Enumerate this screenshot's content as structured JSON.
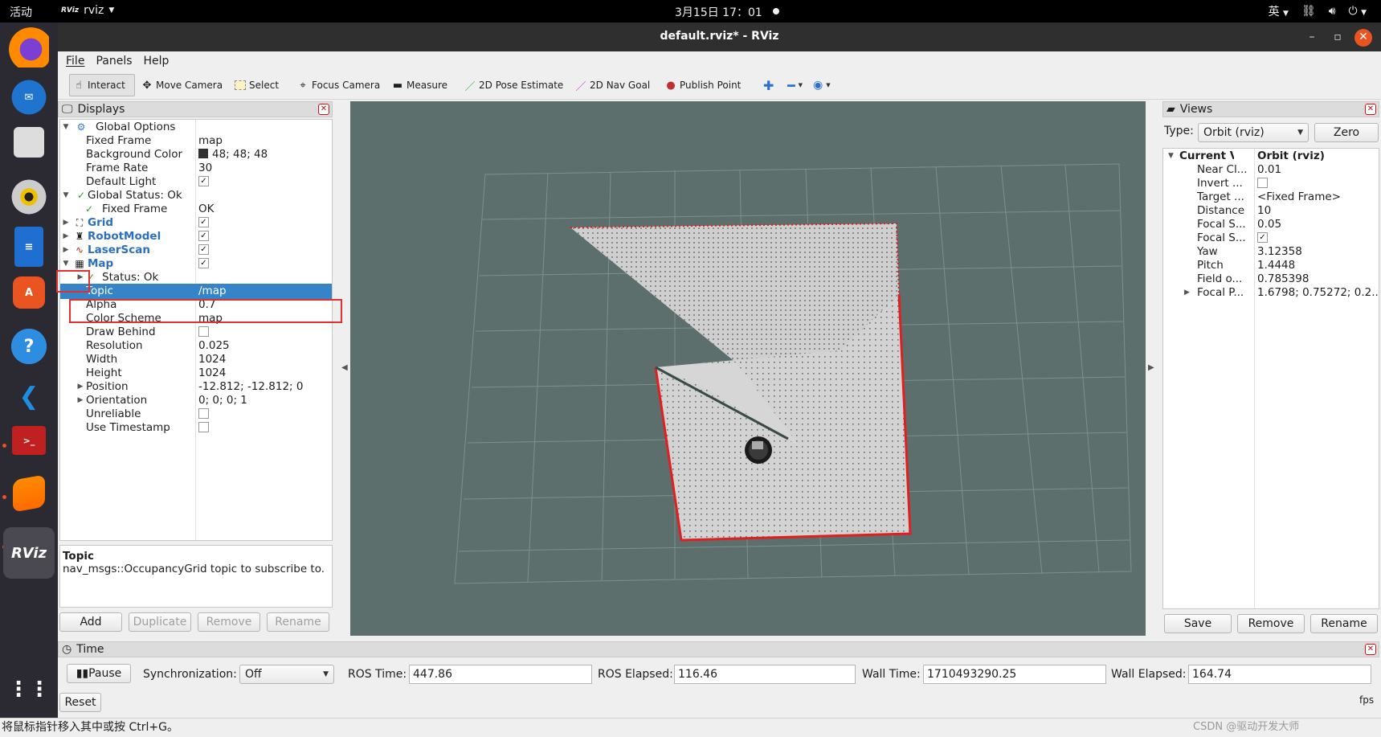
{
  "topbar": {
    "activities": "活动",
    "app_name": "rviz",
    "app_icon": "RViz",
    "clock": "3月15日  17：01",
    "input_method": "英"
  },
  "dock": {
    "items": [
      "firefox",
      "thunderbird",
      "files",
      "rhythmbox",
      "writer",
      "software",
      "help",
      "vscode",
      "terminal",
      "sublime",
      "rviz",
      "apps-grid"
    ],
    "rviz_label": "RViz"
  },
  "window": {
    "title": "default.rviz* - RViz"
  },
  "menu": {
    "file": "File",
    "panels": "Panels",
    "help": "Help"
  },
  "toolbar": {
    "interact": "Interact",
    "move_camera": "Move Camera",
    "select": "Select",
    "focus_camera": "Focus Camera",
    "measure": "Measure",
    "pose_estimate": "2D Pose Estimate",
    "nav_goal": "2D Nav Goal",
    "publish_point": "Publish Point"
  },
  "displays": {
    "title": "Displays",
    "global_options": "Global Options",
    "fixed_frame_label": "Fixed Frame",
    "fixed_frame": "map",
    "bg_color_label": "Background Color",
    "bg_color": "48; 48; 48",
    "frame_rate_label": "Frame Rate",
    "frame_rate": "30",
    "default_light_label": "Default Light",
    "global_status": "Global Status: Ok",
    "status_fixed_frame_label": "Fixed Frame",
    "status_fixed_frame": "OK",
    "grid": "Grid",
    "robot_model": "RobotModel",
    "laser_scan": "LaserScan",
    "map": "Map",
    "map_status": "Status: Ok",
    "topic_label": "Topic",
    "topic": "/map",
    "alpha_label": "Alpha",
    "alpha": "0.7",
    "color_scheme_label": "Color Scheme",
    "color_scheme": "map",
    "draw_behind_label": "Draw Behind",
    "resolution_label": "Resolution",
    "resolution": "0.025",
    "width_label": "Width",
    "width": "1024",
    "height_label": "Height",
    "height": "1024",
    "position_label": "Position",
    "position": "-12.812; -12.812; 0",
    "orientation_label": "Orientation",
    "orientation": "0; 0; 0; 1",
    "unreliable_label": "Unreliable",
    "use_timestamp_label": "Use Timestamp",
    "desc_title": "Topic",
    "desc_text": "nav_msgs::OccupancyGrid topic to subscribe to.",
    "buttons": {
      "add": "Add",
      "duplicate": "Duplicate",
      "remove": "Remove",
      "rename": "Rename"
    }
  },
  "views": {
    "title": "Views",
    "type_label": "Type:",
    "type_value": "Orbit (rviz)",
    "zero": "Zero",
    "rows": [
      {
        "label": "Current V...",
        "value": "Orbit (rviz)"
      },
      {
        "label": "Near Cl...",
        "value": "0.01"
      },
      {
        "label": "Invert ...",
        "value": ""
      },
      {
        "label": "Target ...",
        "value": "<Fixed Frame>"
      },
      {
        "label": "Distance",
        "value": "10"
      },
      {
        "label": "Focal S...",
        "value": "0.05"
      },
      {
        "label": "Focal S...",
        "value": ""
      },
      {
        "label": "Yaw",
        "value": "3.12358"
      },
      {
        "label": "Pitch",
        "value": "1.4448"
      },
      {
        "label": "Field o...",
        "value": "0.785398"
      },
      {
        "label": "Focal P...",
        "value": "1.6798; 0.75272; 0.2..."
      }
    ],
    "buttons": {
      "save": "Save",
      "remove": "Remove",
      "rename": "Rename"
    }
  },
  "time": {
    "title": "Time",
    "pause": "Pause",
    "sync_label": "Synchronization:",
    "sync_value": "Off",
    "ros_time_label": "ROS Time:",
    "ros_time": "447.86",
    "ros_elapsed_label": "ROS Elapsed:",
    "ros_elapsed": "116.46",
    "wall_time_label": "Wall Time:",
    "wall_time": "1710493290.25",
    "wall_elapsed_label": "Wall Elapsed:",
    "wall_elapsed": "164.74",
    "reset": "Reset"
  },
  "status_bar": "将鼠标指针移入其中或按 Ctrl+G。",
  "watermark": "CSDN @驱动开发大师",
  "fps": "fps",
  "colors": {
    "background": "#303030",
    "selection": "#3584c8",
    "highlight_box": "#e03030",
    "map_free": "#cfcfcf",
    "map_border": "#e02020"
  }
}
